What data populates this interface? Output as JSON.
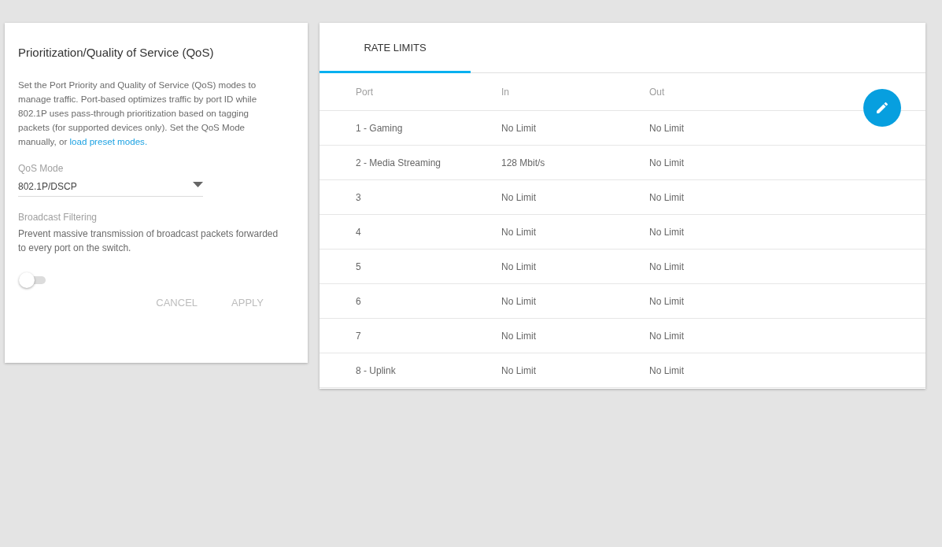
{
  "qos_panel": {
    "title": "Prioritization/Quality of Service (QoS)",
    "description": "Set the Port Priority and Quality of Service (QoS) modes to manage traffic. Port-based optimizes traffic by port ID while 802.1P uses pass-through prioritization based on tagging packets (for supported devices only). Set the QoS Mode manually, or ",
    "link": "load preset modes.",
    "qos_mode": {
      "label": "QoS Mode",
      "value": "802.1P/DSCP"
    },
    "broadcast_filtering": {
      "label": "Broadcast Filtering",
      "description": "Prevent massive transmission of broadcast packets forwarded to every port on the switch.",
      "on": false
    },
    "buttons": [
      {
        "label": "CANCEL",
        "disabled": true
      },
      {
        "label": "APPLY",
        "disabled": true
      }
    ]
  },
  "rate_limits": {
    "tabs": [
      {
        "label": "RATE LIMITS",
        "selected": true
      }
    ],
    "table": {
      "columns": [
        "Port",
        "In",
        "Out"
      ],
      "rows": [
        [
          "1 - Gaming",
          "No Limit",
          "No Limit"
        ],
        [
          "2 - Media Streaming",
          "128 Mbit/s",
          "No Limit"
        ],
        [
          "3",
          "No Limit",
          "No Limit"
        ],
        [
          "4",
          "No Limit",
          "No Limit"
        ],
        [
          "5",
          "No Limit",
          "No Limit"
        ],
        [
          "6",
          "No Limit",
          "No Limit"
        ],
        [
          "7",
          "No Limit",
          "No Limit"
        ],
        [
          "8 - Uplink",
          "No Limit",
          "No Limit"
        ]
      ]
    }
  }
}
